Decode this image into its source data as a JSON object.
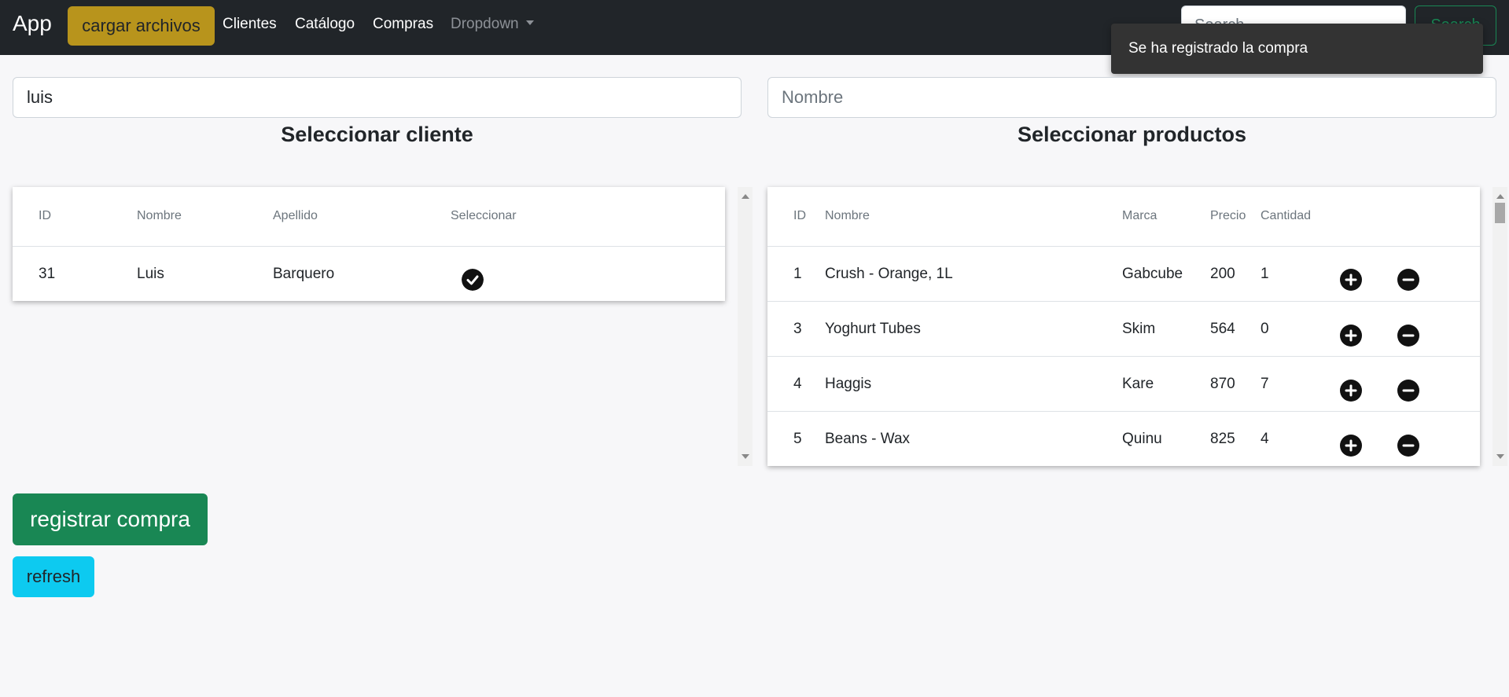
{
  "navbar": {
    "brand": "App",
    "upload_label": "cargar archivos",
    "links": [
      "Clientes",
      "Catálogo",
      "Compras"
    ],
    "dropdown_label": "Dropdown",
    "search_placeholder": "Search",
    "search_button": "Search"
  },
  "toast": {
    "message": "Se ha registrado la compra"
  },
  "clients": {
    "search_value": "luis",
    "title": "Seleccionar cliente",
    "columns": [
      "ID",
      "Nombre",
      "Apellido",
      "Seleccionar"
    ],
    "rows": [
      {
        "id": "31",
        "nombre": "Luis",
        "apellido": "Barquero",
        "seleccionar_icon": "check-circle-icon"
      }
    ]
  },
  "products": {
    "search_placeholder": "Nombre",
    "title": "Seleccionar productos",
    "columns": [
      "ID",
      "Nombre",
      "Marca",
      "Precio",
      "Cantidad"
    ],
    "rows": [
      {
        "id": "1",
        "nombre": "Crush - Orange, 1L",
        "marca": "Gabcube",
        "precio": "200",
        "cantidad": "1"
      },
      {
        "id": "3",
        "nombre": "Yoghurt Tubes",
        "marca": "Skim",
        "precio": "564",
        "cantidad": "0"
      },
      {
        "id": "4",
        "nombre": "Haggis",
        "marca": "Kare",
        "precio": "870",
        "cantidad": "7"
      },
      {
        "id": "5",
        "nombre": "Beans - Wax",
        "marca": "Quinu",
        "precio": "825",
        "cantidad": "4"
      }
    ],
    "row_icons": [
      "plus-circle-icon",
      "minus-circle-icon"
    ]
  },
  "actions": {
    "register_label": "registrar compra",
    "refresh_label": "refresh"
  },
  "colors": {
    "navbar_bg": "#212529",
    "upload_button": "#b8941c",
    "register_button": "#198754",
    "refresh_button": "#0dcaf0",
    "toast_bg": "#333333"
  }
}
